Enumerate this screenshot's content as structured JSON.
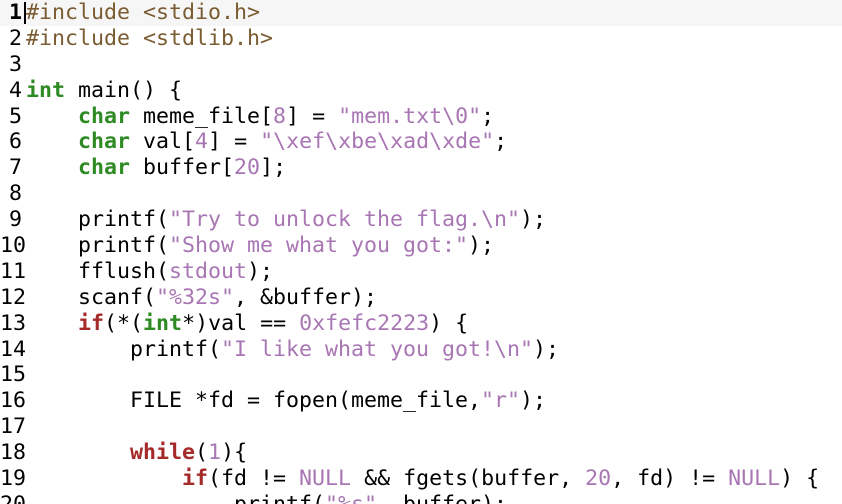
{
  "editor": {
    "current_line": 1,
    "colors": {
      "preprocessor": "#7b5c32",
      "type": "#2e8b24",
      "keyword": "#a52a2a",
      "string": "#a976b4",
      "number": "#a976b4",
      "plain": "#000000",
      "current_line_bg": "#f6f6f6"
    },
    "lines": [
      {
        "number": "1",
        "segments": [
          {
            "t": "pp",
            "v": "#include <stdio.h>"
          }
        ]
      },
      {
        "number": "2",
        "segments": [
          {
            "t": "pp",
            "v": "#include <stdlib.h>"
          }
        ]
      },
      {
        "number": "3",
        "segments": []
      },
      {
        "number": "4",
        "segments": [
          {
            "t": "ty",
            "v": "int"
          },
          {
            "t": "pl",
            "v": " main() {"
          }
        ]
      },
      {
        "number": "5",
        "segments": [
          {
            "t": "pl",
            "v": "    "
          },
          {
            "t": "ty",
            "v": "char"
          },
          {
            "t": "pl",
            "v": " meme_file["
          },
          {
            "t": "num",
            "v": "8"
          },
          {
            "t": "pl",
            "v": "] = "
          },
          {
            "t": "st",
            "v": "\"mem.txt\\0\""
          },
          {
            "t": "pl",
            "v": ";"
          }
        ]
      },
      {
        "number": "6",
        "segments": [
          {
            "t": "pl",
            "v": "    "
          },
          {
            "t": "ty",
            "v": "char"
          },
          {
            "t": "pl",
            "v": " val["
          },
          {
            "t": "num",
            "v": "4"
          },
          {
            "t": "pl",
            "v": "] = "
          },
          {
            "t": "st",
            "v": "\"\\xef\\xbe\\xad\\xde\""
          },
          {
            "t": "pl",
            "v": ";"
          }
        ]
      },
      {
        "number": "7",
        "segments": [
          {
            "t": "pl",
            "v": "    "
          },
          {
            "t": "ty",
            "v": "char"
          },
          {
            "t": "pl",
            "v": " buffer["
          },
          {
            "t": "num",
            "v": "20"
          },
          {
            "t": "pl",
            "v": "];"
          }
        ]
      },
      {
        "number": "8",
        "segments": []
      },
      {
        "number": "9",
        "segments": [
          {
            "t": "pl",
            "v": "    printf("
          },
          {
            "t": "st",
            "v": "\"Try to unlock the flag.\\n\""
          },
          {
            "t": "pl",
            "v": ");"
          }
        ]
      },
      {
        "number": "10",
        "segments": [
          {
            "t": "pl",
            "v": "    printf("
          },
          {
            "t": "st",
            "v": "\"Show me what you got:\""
          },
          {
            "t": "pl",
            "v": ");"
          }
        ]
      },
      {
        "number": "11",
        "segments": [
          {
            "t": "pl",
            "v": "    fflush("
          },
          {
            "t": "st",
            "v": "stdout"
          },
          {
            "t": "pl",
            "v": ");"
          }
        ]
      },
      {
        "number": "12",
        "segments": [
          {
            "t": "pl",
            "v": "    scanf("
          },
          {
            "t": "st",
            "v": "\"%32s\""
          },
          {
            "t": "pl",
            "v": ", &buffer);"
          }
        ]
      },
      {
        "number": "13",
        "segments": [
          {
            "t": "pl",
            "v": "    "
          },
          {
            "t": "kw",
            "v": "if"
          },
          {
            "t": "pl",
            "v": "(*("
          },
          {
            "t": "ty",
            "v": "int"
          },
          {
            "t": "pl",
            "v": "*)val == "
          },
          {
            "t": "num",
            "v": "0xfefc2223"
          },
          {
            "t": "pl",
            "v": ") {"
          }
        ]
      },
      {
        "number": "14",
        "segments": [
          {
            "t": "pl",
            "v": "        printf("
          },
          {
            "t": "st",
            "v": "\"I like what you got!\\n\""
          },
          {
            "t": "pl",
            "v": ");"
          }
        ]
      },
      {
        "number": "15",
        "segments": []
      },
      {
        "number": "16",
        "segments": [
          {
            "t": "pl",
            "v": "        FILE *fd = fopen(meme_file,"
          },
          {
            "t": "st",
            "v": "\"r\""
          },
          {
            "t": "pl",
            "v": ");"
          }
        ]
      },
      {
        "number": "17",
        "segments": []
      },
      {
        "number": "18",
        "segments": [
          {
            "t": "pl",
            "v": "        "
          },
          {
            "t": "kw",
            "v": "while"
          },
          {
            "t": "pl",
            "v": "("
          },
          {
            "t": "num",
            "v": "1"
          },
          {
            "t": "pl",
            "v": "){"
          }
        ]
      },
      {
        "number": "19",
        "segments": [
          {
            "t": "pl",
            "v": "            "
          },
          {
            "t": "kw",
            "v": "if"
          },
          {
            "t": "pl",
            "v": "(fd != "
          },
          {
            "t": "st",
            "v": "NULL"
          },
          {
            "t": "pl",
            "v": " && fgets(buffer, "
          },
          {
            "t": "num",
            "v": "20"
          },
          {
            "t": "pl",
            "v": ", fd) != "
          },
          {
            "t": "st",
            "v": "NULL"
          },
          {
            "t": "pl",
            "v": ") {"
          }
        ]
      },
      {
        "number": "20",
        "segments": [
          {
            "t": "pl",
            "v": "                printf("
          },
          {
            "t": "st",
            "v": "\"%s\""
          },
          {
            "t": "pl",
            "v": ", buffer);"
          }
        ]
      }
    ]
  }
}
